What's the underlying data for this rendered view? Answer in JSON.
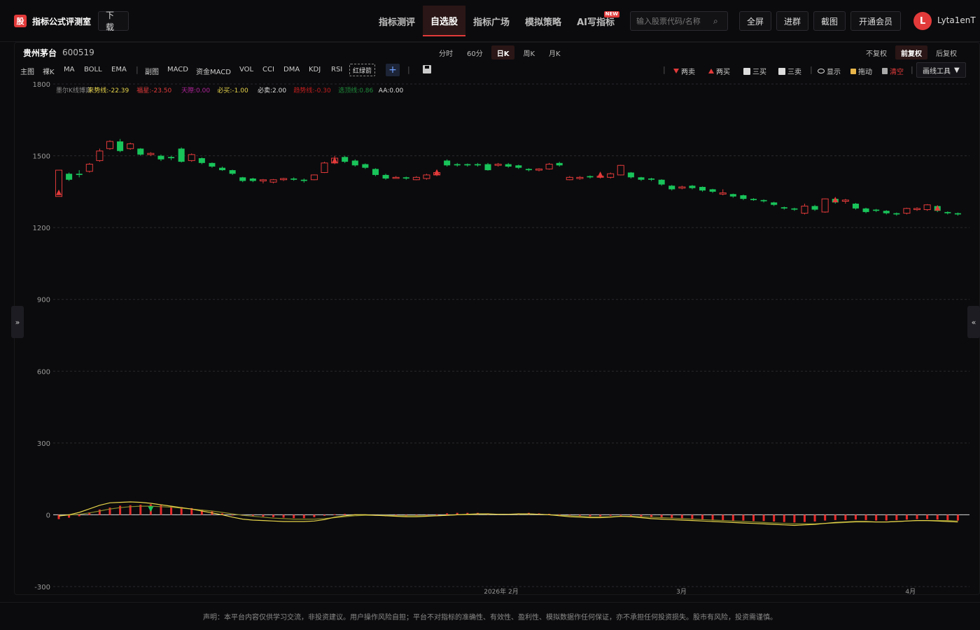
{
  "brand": {
    "logo_glyph": "股",
    "name": "指标公式评测室",
    "download": "下载"
  },
  "nav": [
    {
      "label": "指标测评",
      "active": false
    },
    {
      "label": "自选股",
      "active": true
    },
    {
      "label": "指标广场",
      "active": false
    },
    {
      "label": "模拟策略",
      "active": false
    },
    {
      "label": "AI写指标",
      "active": false,
      "badge": "NEW"
    }
  ],
  "search": {
    "placeholder": "输入股票代码/名称"
  },
  "top_buttons": {
    "fullscreen": "全屏",
    "join_group": "进群",
    "screenshot": "截图",
    "vip": "开通会员"
  },
  "user": {
    "avatar_initial": "L",
    "name": "Lyta1enT"
  },
  "stock": {
    "name": "贵州茅台",
    "code": "600519"
  },
  "periods": [
    {
      "label": "分时",
      "active": false
    },
    {
      "label": "60分",
      "active": false
    },
    {
      "label": "日K",
      "active": true
    },
    {
      "label": "周K",
      "active": false
    },
    {
      "label": "月K",
      "active": false
    }
  ],
  "adjust": [
    {
      "label": "不复权",
      "active": false
    },
    {
      "label": "前复权",
      "active": true
    },
    {
      "label": "后复权",
      "active": false
    }
  ],
  "indicators": {
    "main": "主图",
    "naked_k": "裸K",
    "ma": "MA",
    "boll": "BOLL",
    "ema": "EMA",
    "sub": "副图",
    "macd": "MACD",
    "fund_macd": "资金MACD",
    "vol": "VOL",
    "cci": "CCI",
    "dma": "DMA",
    "kdj": "KDJ",
    "rsi": "RSI",
    "hongluo": "红绿箭"
  },
  "tools": {
    "two_sell": "两卖",
    "two_buy": "两买",
    "three_buy": "三买",
    "three_sell": "三卖",
    "show": "显示",
    "drag": "拖动",
    "clear": "清空",
    "draw_tool": "画线工具"
  },
  "colors": {
    "up": "#e23a3a",
    "down": "#19c45a",
    "accent": "#e23a3a",
    "yellow": "#e6d34a"
  },
  "legend": [
    {
      "label": "墨尔K线博弈",
      "color": "#888888"
    },
    {
      "label": "来势线:-22.39",
      "color": "#e6d34a"
    },
    {
      "label": "福星:-23.50",
      "color": "#e23a3a"
    },
    {
      "label": "天際:0.00",
      "color": "#b0249a"
    },
    {
      "label": "必买:-1.00",
      "color": "#e6d34a"
    },
    {
      "label": "必卖:2.00",
      "color": "#dddddd"
    },
    {
      "label": "趋势线:-0.30",
      "color": "#c41e1e"
    },
    {
      "label": "选顶线:0.86",
      "color": "#1f8a3a"
    },
    {
      "label": "AA:0.00",
      "color": "#dddddd"
    }
  ],
  "chart_data": {
    "type": "candlestick",
    "ylim": [
      -300,
      1800
    ],
    "yticks": [
      1800,
      1500,
      1200,
      900,
      600,
      300,
      0,
      -300
    ],
    "xticks": [
      "2026年 2月",
      "3月",
      "4月"
    ],
    "candles": [
      [
        1330,
        1440,
        1440,
        1330
      ],
      [
        1425,
        1400,
        1430,
        1395
      ],
      [
        1425,
        1420,
        1440,
        1410
      ],
      [
        1435,
        1465,
        1470,
        1430
      ],
      [
        1480,
        1520,
        1530,
        1475
      ],
      [
        1530,
        1560,
        1565,
        1525
      ],
      [
        1560,
        1520,
        1570,
        1515
      ],
      [
        1530,
        1550,
        1555,
        1525
      ],
      [
        1530,
        1505,
        1532,
        1500
      ],
      [
        1505,
        1510,
        1515,
        1500
      ],
      [
        1500,
        1485,
        1505,
        1478
      ],
      [
        1495,
        1490,
        1500,
        1482
      ],
      [
        1530,
        1475,
        1535,
        1472
      ],
      [
        1480,
        1505,
        1510,
        1475
      ],
      [
        1490,
        1470,
        1493,
        1465
      ],
      [
        1470,
        1455,
        1472,
        1450
      ],
      [
        1450,
        1440,
        1455,
        1437
      ],
      [
        1440,
        1425,
        1442,
        1420
      ],
      [
        1410,
        1395,
        1412,
        1390
      ],
      [
        1405,
        1395,
        1408,
        1390
      ],
      [
        1395,
        1400,
        1403,
        1385
      ],
      [
        1390,
        1400,
        1403,
        1385
      ],
      [
        1400,
        1405,
        1408,
        1395
      ],
      [
        1405,
        1400,
        1410,
        1396
      ],
      [
        1400,
        1395,
        1405,
        1388
      ],
      [
        1400,
        1420,
        1422,
        1398
      ],
      [
        1430,
        1470,
        1475,
        1428
      ],
      [
        1470,
        1490,
        1500,
        1465
      ],
      [
        1495,
        1475,
        1500,
        1470
      ],
      [
        1480,
        1460,
        1485,
        1455
      ],
      [
        1465,
        1450,
        1468,
        1445
      ],
      [
        1445,
        1420,
        1448,
        1415
      ],
      [
        1420,
        1405,
        1425,
        1400
      ],
      [
        1408,
        1410,
        1415,
        1405
      ],
      [
        1410,
        1405,
        1413,
        1400
      ],
      [
        1400,
        1410,
        1415,
        1398
      ],
      [
        1405,
        1420,
        1425,
        1400
      ],
      [
        1420,
        1430,
        1432,
        1415
      ],
      [
        1480,
        1460,
        1485,
        1455
      ],
      [
        1465,
        1460,
        1470,
        1455
      ],
      [
        1465,
        1460,
        1468,
        1455
      ],
      [
        1465,
        1460,
        1470,
        1455
      ],
      [
        1465,
        1440,
        1470,
        1438
      ],
      [
        1460,
        1465,
        1470,
        1455
      ],
      [
        1465,
        1455,
        1470,
        1450
      ],
      [
        1460,
        1450,
        1463,
        1445
      ],
      [
        1445,
        1440,
        1448,
        1435
      ],
      [
        1440,
        1445,
        1448,
        1435
      ],
      [
        1445,
        1465,
        1470,
        1442
      ],
      [
        1470,
        1460,
        1475,
        1455
      ],
      [
        1400,
        1410,
        1415,
        1398
      ],
      [
        1405,
        1410,
        1415,
        1400
      ],
      [
        1415,
        1410,
        1418,
        1405
      ],
      [
        1410,
        1415,
        1418,
        1405
      ],
      [
        1410,
        1425,
        1430,
        1405
      ],
      [
        1420,
        1460,
        1462,
        1418
      ],
      [
        1430,
        1410,
        1432,
        1405
      ],
      [
        1410,
        1400,
        1412,
        1395
      ],
      [
        1405,
        1400,
        1408,
        1395
      ],
      [
        1400,
        1380,
        1402,
        1375
      ],
      [
        1375,
        1360,
        1378,
        1355
      ],
      [
        1365,
        1370,
        1375,
        1360
      ],
      [
        1375,
        1365,
        1378,
        1360
      ],
      [
        1370,
        1355,
        1372,
        1350
      ],
      [
        1360,
        1350,
        1362,
        1345
      ],
      [
        1340,
        1345,
        1360,
        1335
      ],
      [
        1340,
        1330,
        1342,
        1325
      ],
      [
        1335,
        1320,
        1338,
        1315
      ],
      [
        1320,
        1315,
        1323,
        1312
      ],
      [
        1315,
        1310,
        1318,
        1305
      ],
      [
        1305,
        1295,
        1308,
        1290
      ],
      [
        1285,
        1280,
        1288,
        1275
      ],
      [
        1280,
        1275,
        1283,
        1270
      ],
      [
        1260,
        1290,
        1300,
        1255
      ],
      [
        1290,
        1275,
        1295,
        1270
      ],
      [
        1265,
        1320,
        1322,
        1262
      ],
      [
        1320,
        1305,
        1325,
        1300
      ],
      [
        1310,
        1315,
        1320,
        1300
      ],
      [
        1300,
        1280,
        1303,
        1275
      ],
      [
        1280,
        1265,
        1283,
        1260
      ],
      [
        1275,
        1270,
        1278,
        1265
      ],
      [
        1270,
        1260,
        1273,
        1255
      ],
      [
        1260,
        1255,
        1263,
        1250
      ],
      [
        1260,
        1280,
        1283,
        1255
      ],
      [
        1275,
        1280,
        1285,
        1270
      ],
      [
        1275,
        1295,
        1298,
        1270
      ],
      [
        1290,
        1270,
        1293,
        1265
      ],
      [
        1265,
        1260,
        1268,
        1255
      ],
      [
        1260,
        1255,
        1263,
        1250
      ]
    ],
    "markers": [
      {
        "index": 0,
        "type": "buy"
      },
      {
        "index": 27,
        "type": "buy"
      },
      {
        "index": 37,
        "type": "buy"
      },
      {
        "index": 53,
        "type": "buy"
      },
      {
        "index": 76,
        "type": "buy"
      },
      {
        "index": 86,
        "type": "buy"
      }
    ],
    "macd_hist": [
      -18,
      -12,
      -6,
      10,
      22,
      30,
      38,
      40,
      42,
      44,
      40,
      36,
      32,
      28,
      22,
      14,
      6,
      0,
      -4,
      -6,
      -8,
      -10,
      -12,
      -14,
      -14,
      -10,
      -4,
      2,
      4,
      2,
      -2,
      -4,
      -6,
      -6,
      -6,
      -4,
      -2,
      2,
      6,
      8,
      8,
      8,
      6,
      4,
      4,
      6,
      8,
      6,
      4,
      2,
      -2,
      -4,
      -6,
      -6,
      -4,
      0,
      -4,
      -8,
      -12,
      -14,
      -16,
      -18,
      -20,
      -20,
      -22,
      -22,
      -24,
      -24,
      -26,
      -26,
      -28,
      -30,
      -32,
      -30,
      -28,
      -24,
      -22,
      -22,
      -20,
      -22,
      -24,
      -24,
      -22,
      -20,
      -18,
      -18,
      -20,
      -22,
      -24
    ],
    "dif": [
      -5,
      0,
      10,
      25,
      40,
      50,
      52,
      54,
      52,
      48,
      42,
      36,
      30,
      24,
      16,
      8,
      0,
      -10,
      -18,
      -22,
      -24,
      -26,
      -28,
      -28,
      -28,
      -26,
      -20,
      -10,
      -4,
      0,
      0,
      -2,
      -4,
      -6,
      -8,
      -8,
      -6,
      -4,
      -2,
      0,
      2,
      4,
      4,
      2,
      2,
      4,
      4,
      2,
      0,
      -4,
      -8,
      -10,
      -12,
      -12,
      -10,
      -6,
      -8,
      -12,
      -16,
      -18,
      -20,
      -22,
      -24,
      -26,
      -28,
      -30,
      -32,
      -34,
      -36,
      -38,
      -40,
      -42,
      -44,
      -42,
      -40,
      -36,
      -32,
      -30,
      -28,
      -28,
      -30,
      -30,
      -28,
      -26,
      -24,
      -24,
      -26,
      -28,
      -30
    ],
    "dea": [
      -3,
      -1,
      2,
      8,
      16,
      24,
      30,
      34,
      36,
      36,
      34,
      32,
      28,
      24,
      20,
      16,
      10,
      4,
      -2,
      -6,
      -10,
      -14,
      -16,
      -18,
      -18,
      -18,
      -16,
      -12,
      -8,
      -4,
      -2,
      -2,
      -2,
      -4,
      -4,
      -4,
      -4,
      -4,
      -2,
      0,
      0,
      2,
      2,
      2,
      2,
      2,
      2,
      2,
      0,
      -2,
      -4,
      -6,
      -8,
      -8,
      -8,
      -6,
      -6,
      -8,
      -10,
      -12,
      -14,
      -16,
      -18,
      -20,
      -22,
      -24,
      -26,
      -28,
      -30,
      -32,
      -34,
      -36,
      -38,
      -38,
      -38,
      -36,
      -34,
      -32,
      -30,
      -30,
      -30,
      -30,
      -28,
      -26,
      -24,
      -24,
      -24,
      -24,
      -26
    ]
  },
  "disclaimer": "声明：本平台内容仅供学习交流，非投资建议。用户操作风险自担；平台不对指标的准确性、有效性、盈利性、模拟数据作任何保证，亦不承担任何投资损失。股市有风险，投资需谨慎。"
}
